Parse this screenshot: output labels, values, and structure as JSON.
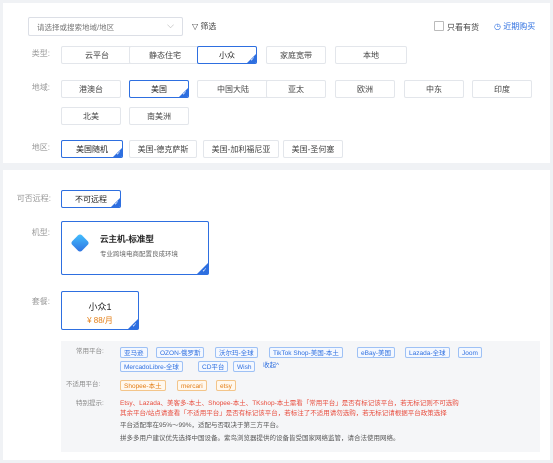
{
  "search": {
    "placeholder": "请选择或搜索地域/地区"
  },
  "filter_label": "筛选",
  "only_stock_label": "只看有货",
  "recent_purchase_label": "近期购买",
  "type": {
    "label": "类型:",
    "options": [
      "云平台",
      "静态住宅",
      "小众",
      "家庭宽带",
      "本地"
    ]
  },
  "region": {
    "label": "地域:",
    "options": [
      "港澳台",
      "美国",
      "中国大陆",
      "亚太",
      "欧洲",
      "中东",
      "印度",
      "北美",
      "南美洲"
    ]
  },
  "area": {
    "label": "地区:",
    "options": [
      "美国随机",
      "美国-德克萨斯",
      "美国-加利福尼亚",
      "美国-圣何塞"
    ]
  },
  "remote": {
    "label": "可否远程:",
    "option": "不可远程"
  },
  "machine": {
    "label": "机型:",
    "title": "云主机-标准型",
    "desc": "专业跨境电商配置良成环境"
  },
  "package": {
    "label": "套餐:",
    "name": "小众1",
    "price": "¥ 88/月"
  },
  "info": {
    "common_label": "常用平台:",
    "common_tags": [
      "亚马逊",
      "OZON-俄罗斯",
      "沃尔玛-全球",
      "TikTok Shop-美国-本土",
      "eBay-美国",
      "Lazada-全球",
      "Joom",
      "MercadoLibre-全球",
      "CD平台",
      "Wish"
    ],
    "collapse": "收起",
    "unsuitable_label": "不适用平台:",
    "unsuitable_tags": [
      "Shopee-本土",
      "mercari",
      "etsy"
    ],
    "tips_label": "特别提示:",
    "tips_red_1": "Etsy、Lazada、美客多-本土、Shopee-本土、TKshop-本土需看「常用平台」是否有标记该平台，若无标记则不可选购",
    "tips_red_2": "其余平台/站点请查看「不适用平台」是否有标记该平台，若标注了不适用请勿选购，若无标记请根据平台政策选择",
    "tips_3": "平台适配率在95%～99%，适配与否取决于第三方平台。",
    "tips_4": "拼多多用户建议优先选择中国设备。紫鸟浏览器提供的设备皆受国家网络监管，请合法使用网络。"
  },
  "colors": {
    "accent": "#2e6fe0",
    "warn": "#e84c3d",
    "orange": "#e37d14"
  }
}
